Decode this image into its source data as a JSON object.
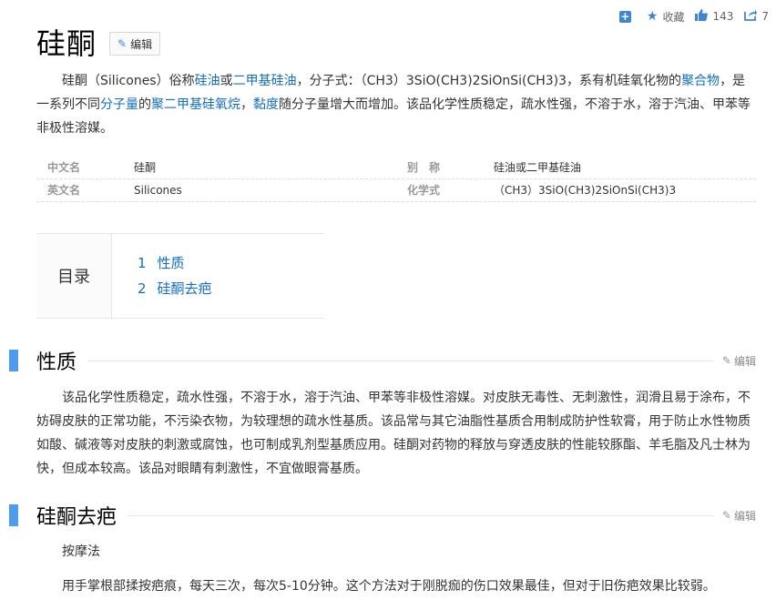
{
  "toolbar": {
    "favorite_label": "收藏",
    "like_count": "143",
    "share_count": "7"
  },
  "title": "硅酮",
  "edit_label": "编辑",
  "summary": {
    "p1": "硅酮（Silicones）俗称",
    "link1": "硅油",
    "p2": "或",
    "link2": "二甲基硅油",
    "p3": "，分子式：（CH3）3SiO(CH3)2SiOnSi(CH3)3，系有机硅氧化物的",
    "link3": "聚合物",
    "p4": "，是一系列不同",
    "link4": "分子量",
    "p5": "的",
    "link5": "聚二甲基硅氧烷",
    "p6": "，",
    "link6": "黏度",
    "p7": "随分子量增大而增加。该品化学性质稳定，疏水性强，不溶于水，溶于汽油、甲苯等非极性溶媒。"
  },
  "basic_info": [
    {
      "k1": "中文名",
      "v1": "硅酮",
      "k2": "别　称",
      "v2": "硅油或二甲基硅油"
    },
    {
      "k1": "英文名",
      "v1": "Silicones",
      "k2": "化学式",
      "v2": "（CH3）3SiO(CH3)2SiOnSi(CH3)3"
    }
  ],
  "catalog": {
    "label": "目录",
    "items": [
      {
        "num": "1",
        "label": "性质"
      },
      {
        "num": "2",
        "label": "硅酮去疤"
      }
    ]
  },
  "sections": [
    {
      "title": "性质",
      "edit": "编辑",
      "paragraphs": [
        "该品化学性质稳定，疏水性强，不溶于水，溶于汽油、甲苯等非极性溶媒。对皮肤无毒性、无刺激性，润滑且易于涂布，不妨碍皮肤的正常功能，不污染衣物，为较理想的疏水性基质。该品常与其它油脂性基质合用制成防护性软膏，用于防止水性物质如酸、碱液等对皮肤的刺激或腐蚀，也可制成乳剂型基质应用。硅酮对药物的释放与穿透皮肤的性能较豚酯、羊毛脂及凡士林为快，但成本较高。该品对眼睛有刺激性，不宜做眼膏基质。"
      ]
    },
    {
      "title": "硅酮去疤",
      "edit": "编辑",
      "paragraphs": [
        "按摩法",
        "用手掌根部揉按疤痕，每天三次，每次5-10分钟。这个方法对于刚脱痂的伤口效果最佳，但对于旧伤疤效果比较弱。"
      ]
    }
  ]
}
